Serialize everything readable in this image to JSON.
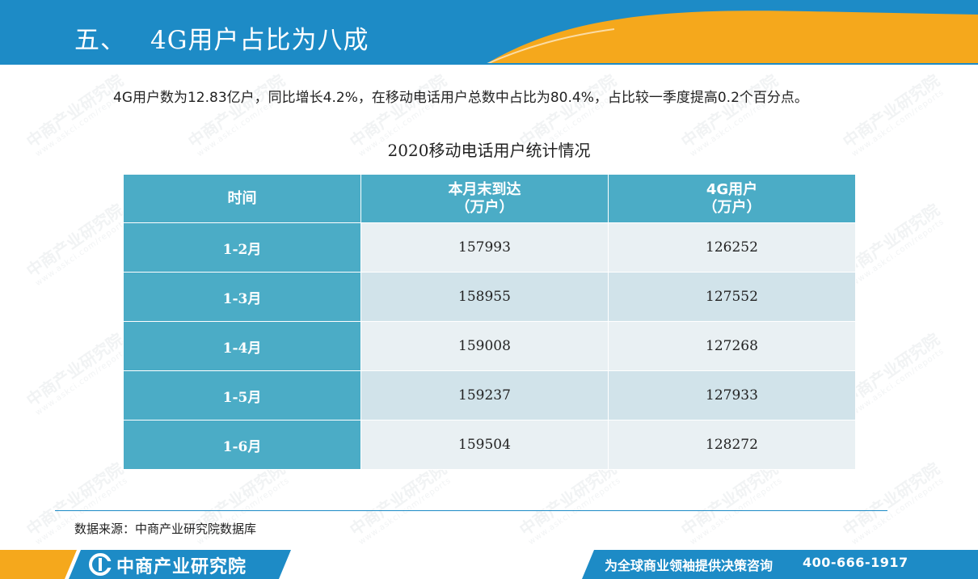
{
  "header": {
    "section_number": "五、",
    "title": "4G用户占比为八成"
  },
  "paragraph": "4G用户数为12.83亿户，同比增长4.2%，在移动电话用户总数中占比为80.4%，占比较一季度提高0.2个百分点。",
  "table": {
    "title": "2020移动电话用户统计情况",
    "headers": {
      "time": "时间",
      "total_line1": "本月末到达",
      "total_line2": "（万户）",
      "fourg_line1": "4G用户",
      "fourg_line2": "（万户）"
    },
    "rows": [
      {
        "time": "1-2月",
        "total": "157993",
        "fourg": "126252"
      },
      {
        "time": "1-3月",
        "total": "158955",
        "fourg": "127552"
      },
      {
        "time": "1-4月",
        "total": "159008",
        "fourg": "127268"
      },
      {
        "time": "1-5月",
        "total": "159237",
        "fourg": "127933"
      },
      {
        "time": "1-6月",
        "total": "159504",
        "fourg": "128272"
      }
    ]
  },
  "watermark": {
    "brand": "中商产业研究院",
    "url": "www.askci.com/reports"
  },
  "footer": {
    "source": "数据来源：中商产业研究院数据库",
    "logo_text": "中商产业研究院",
    "slogan": "为全球商业领袖提供决策咨询",
    "phone": "400-666-1917"
  },
  "colors": {
    "header_blue": "#1d8bc6",
    "accent_orange": "#f5a81c",
    "table_header": "#4bacc6",
    "row_light": "#e9f0f3",
    "row_dark": "#d1e3ea"
  }
}
